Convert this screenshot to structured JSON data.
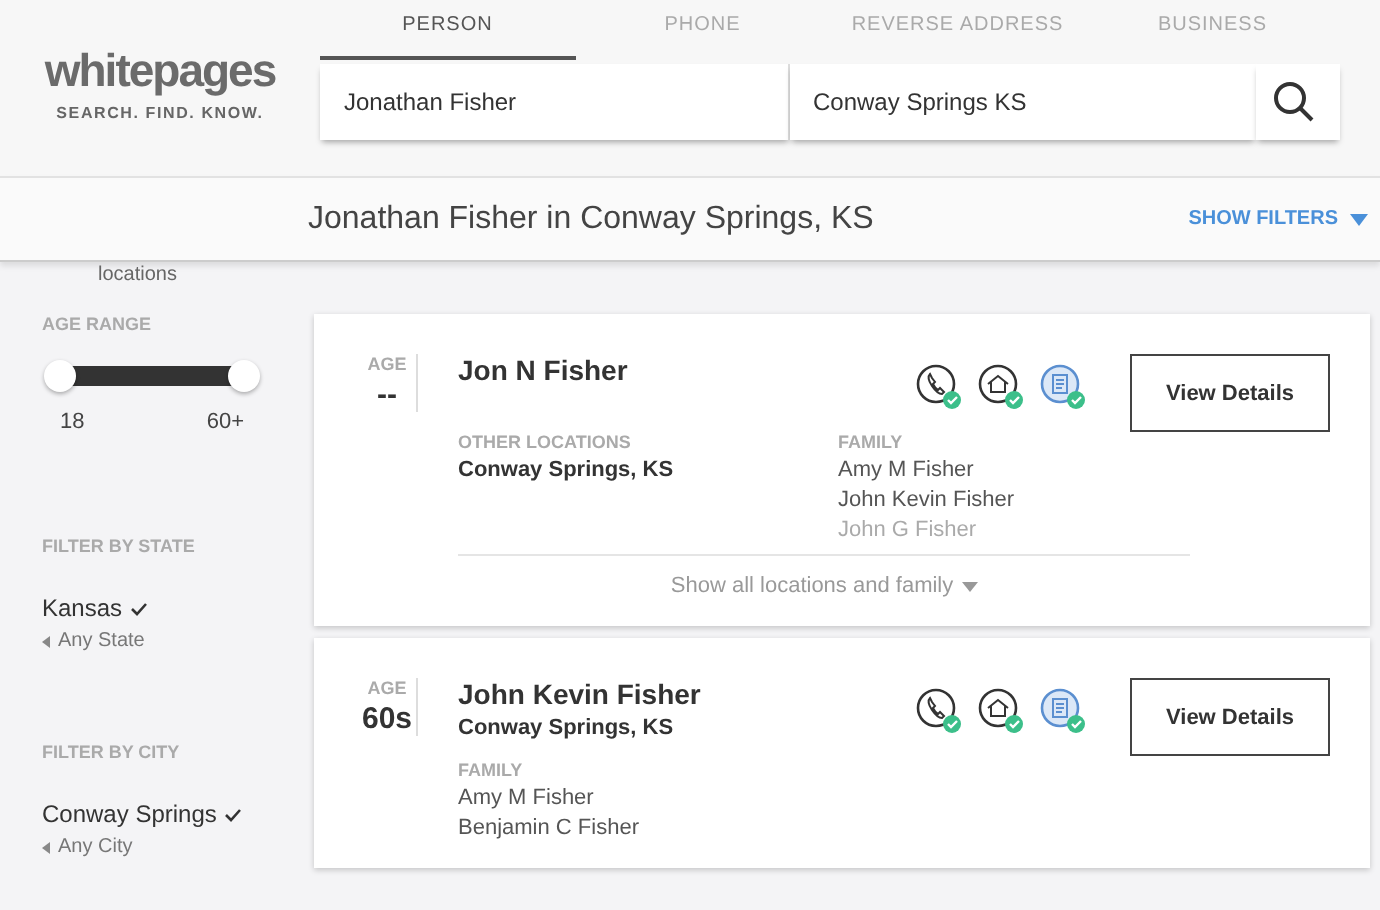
{
  "logo": {
    "wordmark": "whitepages",
    "tagline": "SEARCH. FIND. KNOW."
  },
  "tabs": [
    {
      "label": "PERSON",
      "selected": true
    },
    {
      "label": "PHONE",
      "selected": false
    },
    {
      "label": "REVERSE ADDRESS",
      "selected": false
    },
    {
      "label": "BUSINESS",
      "selected": false
    }
  ],
  "search": {
    "name": "Jonathan Fisher",
    "location": "Conway Springs KS"
  },
  "results_title": "Jonathan Fisher in Conway Springs, KS",
  "show_filters": "SHOW FILTERS",
  "sidebar": {
    "cut_label": "locations",
    "age_range": {
      "title": "AGE RANGE",
      "handles": [
        {
          "level": 0
        },
        {
          "level": 1
        }
      ],
      "min": "18",
      "max": "60+"
    },
    "filters": [
      {
        "title": "FILTER BY STATE",
        "value": "Kansas",
        "back": "Any State"
      },
      {
        "title": "FILTER BY CITY",
        "value": "Conway Springs",
        "back": "Any City"
      }
    ]
  },
  "results": [
    {
      "age_label": "AGE",
      "age": "--",
      "name": "Jon N Fisher",
      "other_locations_label": "OTHER LOCATIONS",
      "other_locations": "Conway Springs, KS",
      "family_label": "FAMILY",
      "family": [
        {
          "name": "Amy M Fisher",
          "faded": false
        },
        {
          "name": "John Kevin Fisher",
          "faded": false
        },
        {
          "name": "John G Fisher",
          "faded": true
        }
      ],
      "show_all": "Show all locations and family",
      "button": "View Details"
    },
    {
      "age_label": "AGE",
      "age": "60s",
      "name": "John Kevin Fisher",
      "location": "Conway Springs, KS",
      "family_label": "FAMILY",
      "family": [
        {
          "name": "Amy M Fisher",
          "faded": false
        },
        {
          "name": "Benjamin C Fisher",
          "faded": false
        }
      ],
      "button": "View Details"
    }
  ]
}
